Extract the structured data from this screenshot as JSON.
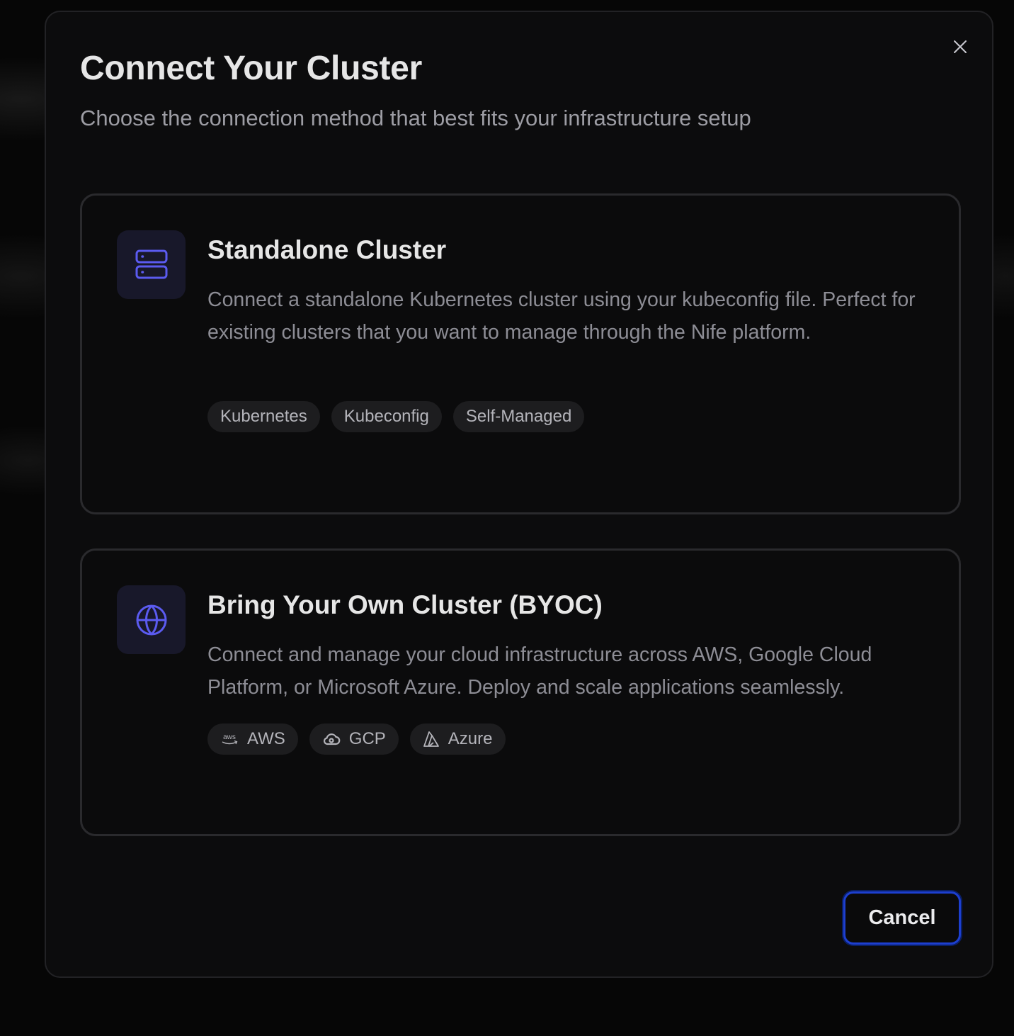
{
  "modal": {
    "title": "Connect Your Cluster",
    "subtitle": "Choose the connection method that best fits your infrastructure setup",
    "close_icon": "close-icon"
  },
  "options": [
    {
      "icon": "server-icon",
      "title": "Standalone Cluster",
      "description": "Connect a standalone Kubernetes cluster using your kubeconfig file. Perfect for existing clusters that you want to manage through the Nife platform.",
      "tags": [
        {
          "label": "Kubernetes"
        },
        {
          "label": "Kubeconfig"
        },
        {
          "label": "Self-Managed"
        }
      ]
    },
    {
      "icon": "globe-icon",
      "title": "Bring Your Own Cluster (BYOC)",
      "description": "Connect and manage your cloud infrastructure across AWS, Google Cloud Platform, or Microsoft Azure. Deploy and scale applications seamlessly.",
      "tags": [
        {
          "label": "AWS",
          "icon": "aws-icon",
          "icon_text": "aws"
        },
        {
          "label": "GCP",
          "icon": "google-cloud-icon"
        },
        {
          "label": "Azure",
          "icon": "azure-icon"
        }
      ]
    }
  ],
  "footer": {
    "cancel_label": "Cancel"
  },
  "colors": {
    "accent": "#5b5bf0",
    "focus_ring": "#1d3fcf",
    "modal_bg": "#0c0c0d",
    "text_primary": "#e6e6e6",
    "text_muted": "#8d8d95"
  }
}
